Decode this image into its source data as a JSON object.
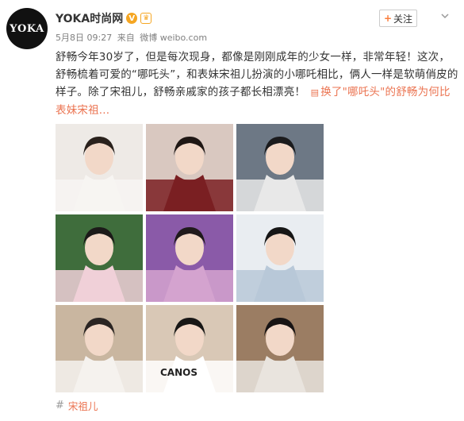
{
  "user": {
    "avatar_text": "YOKA",
    "name": "YOKA时尚网",
    "verified_icon": "verified-v-icon",
    "vip_icon": "vip-icon"
  },
  "meta": {
    "date": "5月8日 09:27",
    "source_prefix": "来自",
    "source": "微博 weibo.com"
  },
  "follow": {
    "plus": "+",
    "label": "关注"
  },
  "post": {
    "text": "舒畅今年30岁了，但是每次现身，都像是刚刚成年的少女一样，非常年轻！这次，舒畅梳着可爱的“哪吒头”，和表妹宋祖儿扮演的小哪吒相比，俩人一样是软萌俏皮的样子。除了宋祖儿，舒畅亲戚家的孩子都长相漂亮！",
    "link_icon": "▤",
    "link_text": "换了\"哪吒头\"的舒畅为何比表妹宋祖...",
    "ellipsis": "..."
  },
  "photos": [
    {
      "name": "photo-1",
      "bg": "#eeeae6",
      "accent": "#f7f5f2",
      "hair": "#2a211c"
    },
    {
      "name": "photo-2",
      "bg": "#d9c8c0",
      "accent": "#7a1f22",
      "hair": "#1f1714"
    },
    {
      "name": "photo-3",
      "bg": "#6d7885",
      "accent": "#e8e8e8",
      "hair": "#1b1b1d"
    },
    {
      "name": "photo-4",
      "bg": "#3f6d3c",
      "accent": "#f0d0d8",
      "hair": "#1c1a19"
    },
    {
      "name": "photo-5",
      "bg": "#8a5aa8",
      "accent": "#d4a3cf",
      "hair": "#201a1c"
    },
    {
      "name": "photo-6",
      "bg": "#e9edf1",
      "accent": "#b8c8d8",
      "hair": "#161616"
    },
    {
      "name": "photo-7",
      "bg": "#c9b6a0",
      "accent": "#f5f2ee",
      "hair": "#2b2523"
    },
    {
      "name": "photo-8",
      "bg": "#d9c8b6",
      "accent": "#ffffff",
      "hair": "#181716"
    },
    {
      "name": "photo-9",
      "bg": "#9b7d63",
      "accent": "#e9e4de",
      "hair": "#181414"
    }
  ],
  "photo_text": {
    "photo-8": "CANOS"
  },
  "topic": {
    "hash": "#",
    "label": "宋祖儿"
  }
}
